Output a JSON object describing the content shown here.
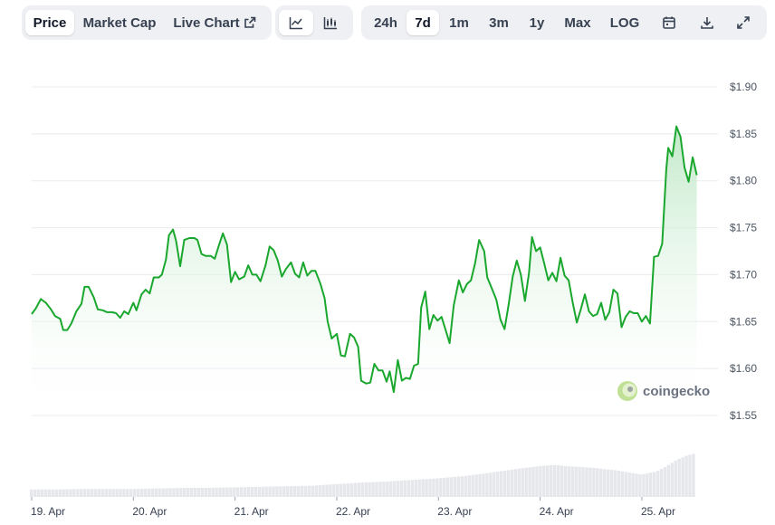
{
  "toolbar": {
    "view_tabs": [
      {
        "label": "Price",
        "active": true
      },
      {
        "label": "Market Cap",
        "active": false
      },
      {
        "label": "Live Chart",
        "active": false,
        "icon": "external-link-icon"
      }
    ],
    "chart_style_buttons": [
      {
        "icon": "line-chart-icon",
        "active": true
      },
      {
        "icon": "candlestick-icon",
        "active": false
      }
    ],
    "ranges": [
      {
        "label": "24h",
        "active": false
      },
      {
        "label": "7d",
        "active": true
      },
      {
        "label": "1m",
        "active": false
      },
      {
        "label": "3m",
        "active": false
      },
      {
        "label": "1y",
        "active": false
      },
      {
        "label": "Max",
        "active": false
      }
    ],
    "log_label": "LOG",
    "action_icons": [
      "calendar-icon",
      "download-icon",
      "fullscreen-icon"
    ]
  },
  "watermark": {
    "text": "coingecko",
    "icon": "coingecko-logo-icon"
  },
  "colors": {
    "line": "#1aa72e",
    "area_top": "#bfe8c6",
    "volume": "#e5e7eb",
    "grid": "#e9ebee"
  },
  "chart_data": {
    "type": "area",
    "title": "",
    "xlabel": "",
    "ylabel": "",
    "y_ticks": [
      "$1.90",
      "$1.85",
      "$1.80",
      "$1.75",
      "$1.70",
      "$1.65",
      "$1.60",
      "$1.55"
    ],
    "y_tick_values": [
      1.9,
      1.85,
      1.8,
      1.75,
      1.7,
      1.65,
      1.6,
      1.55
    ],
    "ylim": [
      1.55,
      1.9
    ],
    "xlim": [
      0,
      7.06
    ],
    "x_ticks": [
      "19. Apr",
      "20. Apr",
      "21. Apr",
      "22. Apr",
      "23. Apr",
      "24. Apr",
      "25. Apr"
    ],
    "x_tick_values": [
      0,
      1,
      2,
      3,
      4,
      5,
      6
    ],
    "grid": true,
    "series": [
      {
        "values": [
          [
            0.0,
            1.658
          ],
          [
            0.04,
            1.664
          ],
          [
            0.09,
            1.674
          ],
          [
            0.14,
            1.67
          ],
          [
            0.19,
            1.663
          ],
          [
            0.23,
            1.656
          ],
          [
            0.28,
            1.653
          ],
          [
            0.31,
            1.641
          ],
          [
            0.35,
            1.641
          ],
          [
            0.39,
            1.648
          ],
          [
            0.44,
            1.661
          ],
          [
            0.49,
            1.669
          ],
          [
            0.52,
            1.687
          ],
          [
            0.56,
            1.687
          ],
          [
            0.61,
            1.676
          ],
          [
            0.65,
            1.663
          ],
          [
            0.7,
            1.662
          ],
          [
            0.74,
            1.66
          ],
          [
            0.79,
            1.66
          ],
          [
            0.83,
            1.659
          ],
          [
            0.87,
            1.654
          ],
          [
            0.91,
            1.661
          ],
          [
            0.95,
            1.658
          ],
          [
            1.0,
            1.67
          ],
          [
            1.03,
            1.662
          ],
          [
            1.08,
            1.679
          ],
          [
            1.12,
            1.684
          ],
          [
            1.16,
            1.68
          ],
          [
            1.2,
            1.697
          ],
          [
            1.25,
            1.697
          ],
          [
            1.28,
            1.7
          ],
          [
            1.32,
            1.716
          ],
          [
            1.35,
            1.742
          ],
          [
            1.39,
            1.748
          ],
          [
            1.42,
            1.736
          ],
          [
            1.46,
            1.709
          ],
          [
            1.5,
            1.737
          ],
          [
            1.55,
            1.739
          ],
          [
            1.6,
            1.739
          ],
          [
            1.63,
            1.737
          ],
          [
            1.67,
            1.722
          ],
          [
            1.71,
            1.72
          ],
          [
            1.76,
            1.72
          ],
          [
            1.8,
            1.717
          ],
          [
            1.84,
            1.731
          ],
          [
            1.88,
            1.744
          ],
          [
            1.92,
            1.732
          ],
          [
            1.96,
            1.692
          ],
          [
            2.0,
            1.703
          ],
          [
            2.04,
            1.695
          ],
          [
            2.09,
            1.698
          ],
          [
            2.13,
            1.71
          ],
          [
            2.17,
            1.7
          ],
          [
            2.21,
            1.7
          ],
          [
            2.25,
            1.693
          ],
          [
            2.3,
            1.71
          ],
          [
            2.34,
            1.73
          ],
          [
            2.38,
            1.726
          ],
          [
            2.42,
            1.715
          ],
          [
            2.46,
            1.698
          ],
          [
            2.5,
            1.706
          ],
          [
            2.55,
            1.713
          ],
          [
            2.59,
            1.701
          ],
          [
            2.63,
            1.697
          ],
          [
            2.67,
            1.713
          ],
          [
            2.71,
            1.699
          ],
          [
            2.75,
            1.704
          ],
          [
            2.79,
            1.704
          ],
          [
            2.84,
            1.69
          ],
          [
            2.88,
            1.675
          ],
          [
            2.91,
            1.65
          ],
          [
            2.95,
            1.632
          ],
          [
            3.0,
            1.637
          ],
          [
            3.04,
            1.614
          ],
          [
            3.08,
            1.613
          ],
          [
            3.13,
            1.637
          ],
          [
            3.17,
            1.633
          ],
          [
            3.21,
            1.623
          ],
          [
            3.24,
            1.587
          ],
          [
            3.29,
            1.584
          ],
          [
            3.33,
            1.585
          ],
          [
            3.37,
            1.605
          ],
          [
            3.41,
            1.598
          ],
          [
            3.45,
            1.598
          ],
          [
            3.49,
            1.586
          ],
          [
            3.52,
            1.597
          ],
          [
            3.56,
            1.575
          ],
          [
            3.6,
            1.609
          ],
          [
            3.64,
            1.587
          ],
          [
            3.68,
            1.59
          ],
          [
            3.72,
            1.589
          ],
          [
            3.76,
            1.603
          ],
          [
            3.8,
            1.605
          ],
          [
            3.83,
            1.665
          ],
          [
            3.87,
            1.682
          ],
          [
            3.91,
            1.642
          ],
          [
            3.95,
            1.657
          ],
          [
            3.99,
            1.651
          ],
          [
            4.03,
            1.655
          ],
          [
            4.07,
            1.641
          ],
          [
            4.11,
            1.627
          ],
          [
            4.15,
            1.667
          ],
          [
            4.2,
            1.694
          ],
          [
            4.24,
            1.681
          ],
          [
            4.28,
            1.69
          ],
          [
            4.32,
            1.694
          ],
          [
            4.36,
            1.712
          ],
          [
            4.4,
            1.737
          ],
          [
            4.45,
            1.725
          ],
          [
            4.48,
            1.697
          ],
          [
            4.53,
            1.684
          ],
          [
            4.57,
            1.673
          ],
          [
            4.61,
            1.652
          ],
          [
            4.65,
            1.642
          ],
          [
            4.69,
            1.668
          ],
          [
            4.73,
            1.698
          ],
          [
            4.77,
            1.715
          ],
          [
            4.81,
            1.7
          ],
          [
            4.85,
            1.672
          ],
          [
            4.89,
            1.702
          ],
          [
            4.92,
            1.74
          ],
          [
            4.96,
            1.725
          ],
          [
            5.0,
            1.729
          ],
          [
            5.04,
            1.712
          ],
          [
            5.08,
            1.694
          ],
          [
            5.12,
            1.702
          ],
          [
            5.16,
            1.693
          ],
          [
            5.2,
            1.718
          ],
          [
            5.24,
            1.699
          ],
          [
            5.28,
            1.694
          ],
          [
            5.32,
            1.67
          ],
          [
            5.36,
            1.649
          ],
          [
            5.4,
            1.663
          ],
          [
            5.44,
            1.679
          ],
          [
            5.48,
            1.661
          ],
          [
            5.52,
            1.656
          ],
          [
            5.56,
            1.658
          ],
          [
            5.6,
            1.67
          ],
          [
            5.64,
            1.652
          ],
          [
            5.68,
            1.66
          ],
          [
            5.72,
            1.684
          ],
          [
            5.76,
            1.68
          ],
          [
            5.8,
            1.644
          ],
          [
            5.84,
            1.655
          ],
          [
            5.88,
            1.661
          ],
          [
            5.92,
            1.659
          ],
          [
            5.96,
            1.659
          ],
          [
            6.0,
            1.65
          ],
          [
            6.04,
            1.656
          ],
          [
            6.08,
            1.648
          ],
          [
            6.12,
            1.719
          ],
          [
            6.16,
            1.72
          ],
          [
            6.2,
            1.733
          ],
          [
            6.24,
            1.812
          ],
          [
            6.26,
            1.835
          ],
          [
            6.3,
            1.826
          ],
          [
            6.34,
            1.858
          ],
          [
            6.38,
            1.847
          ],
          [
            6.42,
            1.814
          ],
          [
            6.46,
            1.799
          ],
          [
            6.5,
            1.825
          ],
          [
            6.54,
            1.806
          ]
        ]
      },
      {
        "name": "volume",
        "values": [
          [
            0.0,
            0.14
          ],
          [
            0.25,
            0.14
          ],
          [
            0.5,
            0.15
          ],
          [
            0.75,
            0.15
          ],
          [
            1.0,
            0.15
          ],
          [
            1.25,
            0.16
          ],
          [
            1.5,
            0.17
          ],
          [
            1.75,
            0.17
          ],
          [
            2.0,
            0.18
          ],
          [
            2.25,
            0.19
          ],
          [
            2.5,
            0.2
          ],
          [
            2.75,
            0.21
          ],
          [
            3.0,
            0.24
          ],
          [
            3.25,
            0.27
          ],
          [
            3.5,
            0.29
          ],
          [
            3.75,
            0.32
          ],
          [
            4.0,
            0.35
          ],
          [
            4.25,
            0.39
          ],
          [
            4.5,
            0.45
          ],
          [
            4.75,
            0.52
          ],
          [
            5.0,
            0.58
          ],
          [
            5.15,
            0.6
          ],
          [
            5.25,
            0.58
          ],
          [
            5.5,
            0.55
          ],
          [
            5.75,
            0.5
          ],
          [
            6.0,
            0.42
          ],
          [
            6.15,
            0.48
          ],
          [
            6.25,
            0.58
          ],
          [
            6.35,
            0.7
          ],
          [
            6.45,
            0.78
          ],
          [
            6.54,
            0.82
          ]
        ]
      }
    ]
  }
}
